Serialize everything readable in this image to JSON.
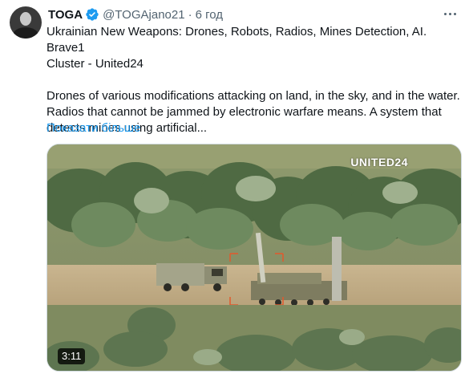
{
  "author": {
    "name": "TOGA",
    "handle": "@TOGAjano21",
    "time": "6 год",
    "verified": true
  },
  "tweet": {
    "title_line_1": "Ukrainian New Weapons: Drones, Robots, Radios, Mines Detection, AI. Brave1",
    "title_line_2": "Cluster - United24",
    "body_line_1": "Drones of various modifications attacking on land, in the sky, and in the water.",
    "body_line_2": "Radios that cannot be jammed by electronic warfare means. A system that",
    "body_line_3": "detects mines using artificial...",
    "show_more": "Показати більше"
  },
  "media": {
    "watermark": "UNITED24",
    "duration": "3:11"
  },
  "colors": {
    "link": "#1d9bf0",
    "verified": "#1d9bf0",
    "secondary_text": "#536471"
  },
  "icons": {
    "verified": "verified-badge-icon",
    "more": "more-options-icon"
  }
}
